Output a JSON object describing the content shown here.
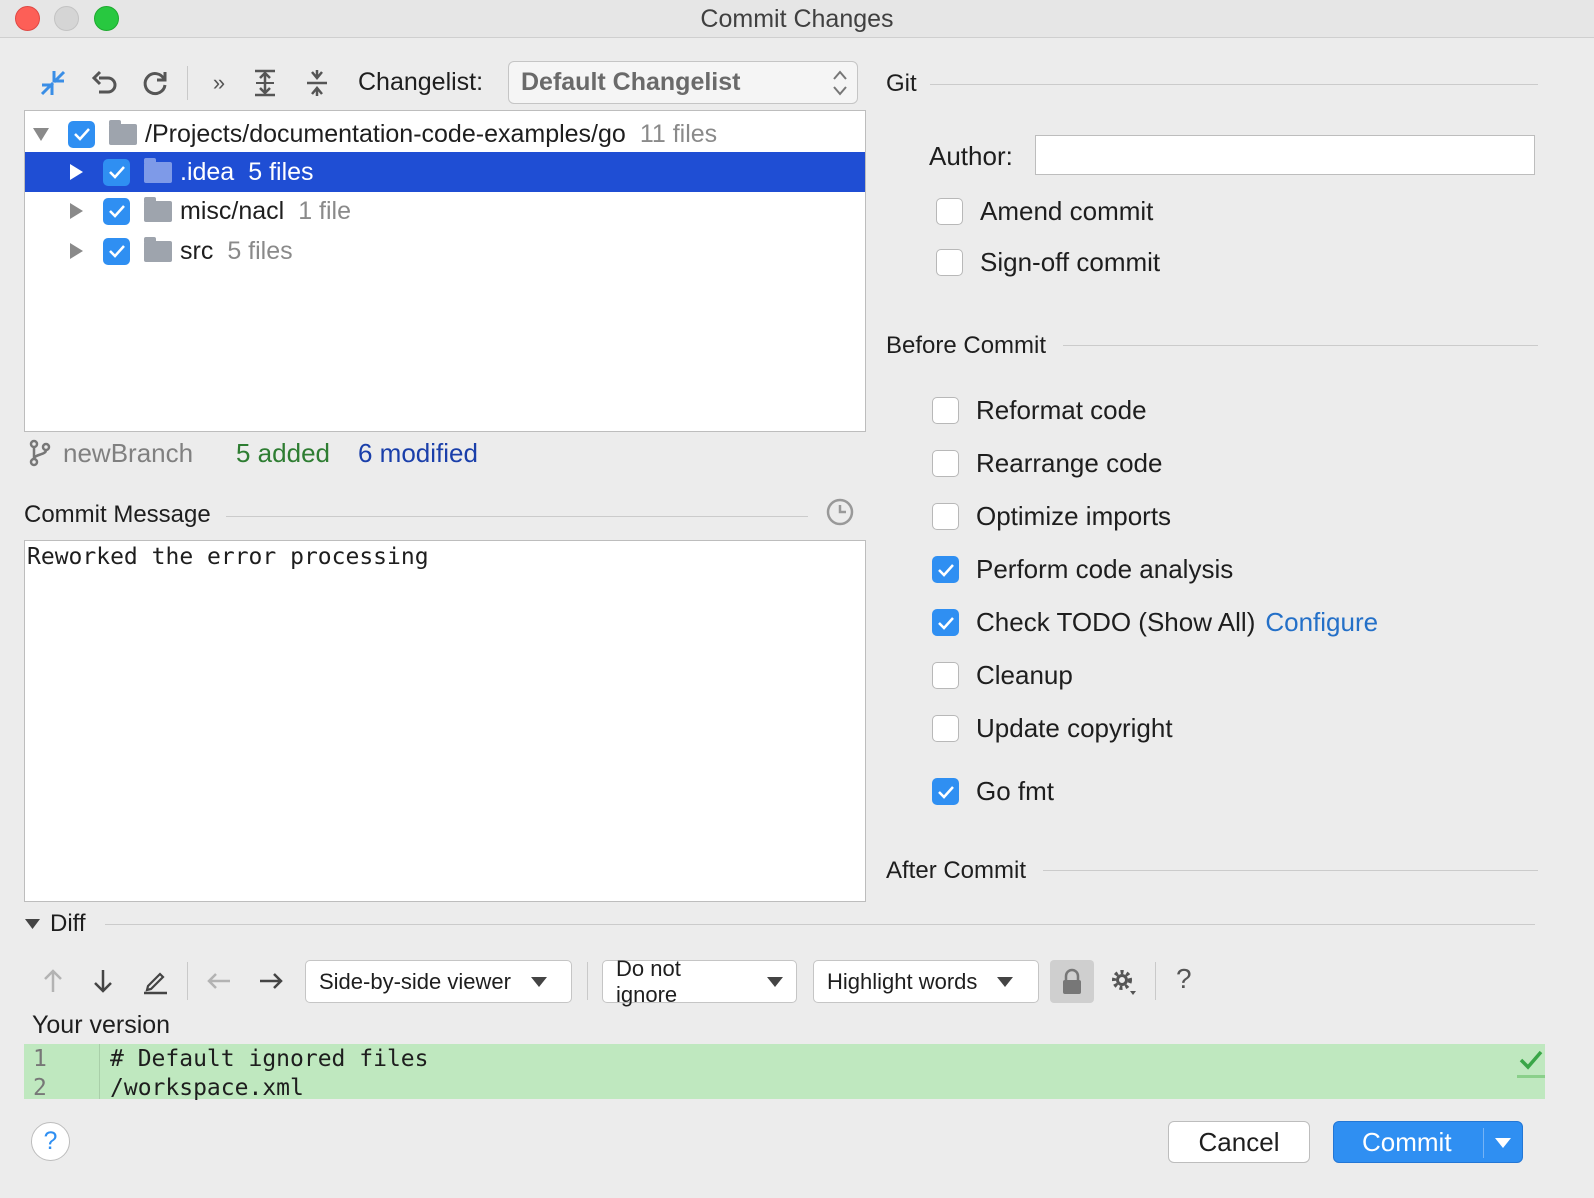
{
  "window": {
    "title": "Commit Changes"
  },
  "toolbar": {
    "changelist_label": "Changelist:",
    "changelist_value": "Default Changelist"
  },
  "tree": {
    "root": {
      "path": "/Projects/documentation-code-examples/go",
      "count": "11 files"
    },
    "items": [
      {
        "name": ".idea",
        "count": "5 files"
      },
      {
        "name": "misc/nacl",
        "count": "1 file"
      },
      {
        "name": "src",
        "count": "5 files"
      }
    ]
  },
  "status": {
    "branch": "newBranch",
    "added": "5 added",
    "modified": "6 modified"
  },
  "commit_message": {
    "label": "Commit Message",
    "text": "Reworked the error processing"
  },
  "git": {
    "title": "Git",
    "author_label": "Author:",
    "author_value": "",
    "amend": "Amend commit",
    "signoff": "Sign-off commit"
  },
  "before_commit": {
    "title": "Before Commit",
    "reformat": "Reformat code",
    "rearrange": "Rearrange code",
    "optimize": "Optimize imports",
    "analysis": "Perform code analysis",
    "todo": "Check TODO (Show All)",
    "configure": "Configure",
    "cleanup": "Cleanup",
    "copyright": "Update copyright",
    "gofmt": "Go fmt"
  },
  "after_commit": {
    "title": "After Commit"
  },
  "diff": {
    "title": "Diff",
    "viewer": "Side-by-side viewer",
    "ignore": "Do not ignore",
    "highlight": "Highlight words",
    "help": "?",
    "your_version": "Your version",
    "lines": [
      {
        "num": "1",
        "text": "# Default ignored files"
      },
      {
        "num": "2",
        "text": "/workspace.xml"
      }
    ]
  },
  "buttons": {
    "help": "?",
    "cancel": "Cancel",
    "commit": "Commit"
  },
  "colors": {
    "accent": "#2f8ff2",
    "selection": "#1f4ed4",
    "added": "#2e7d32",
    "modified": "#1a3faa",
    "diff_bg": "#bfe8bf"
  }
}
